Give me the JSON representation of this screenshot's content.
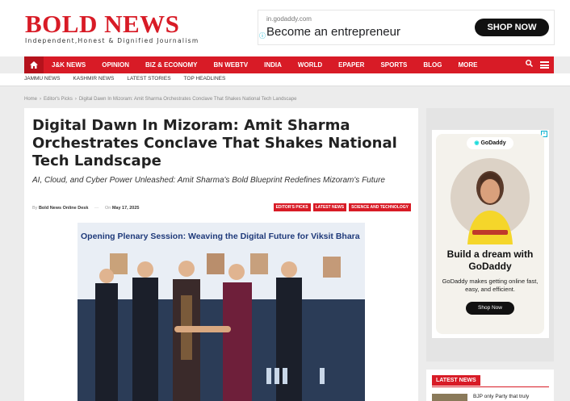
{
  "site": {
    "logo": "BOLD NEWS",
    "tagline": "Independent,Honest & Dignified Journalism"
  },
  "top_ad": {
    "domain": "in.godaddy.com",
    "headline": "Become an entrepreneur",
    "button": "SHOP NOW"
  },
  "nav": {
    "items": [
      "J&K NEWS",
      "OPINION",
      "BIZ & ECONOMY",
      "BN WEBTV",
      "INDIA",
      "WORLD",
      "EPAPER",
      "SPORTS",
      "BLOG",
      "MORE"
    ]
  },
  "subnav": {
    "items": [
      "JAMMU NEWS",
      "KASHMIR NEWS",
      "LATEST STORIES",
      "TOP HEADLINES"
    ]
  },
  "breadcrumb": [
    "Home",
    "Editor's Picks",
    "Digital Dawn In Mizoram: Amit Sharma Orchestrates Conclave That Shakes National Tech Landscape"
  ],
  "article": {
    "title": "Digital Dawn In Mizoram: Amit Sharma Orchestrates Conclave That Shakes National Tech Landscape",
    "subtitle": "AI, Cloud, and Cyber Power Unleashed: Amit Sharma's Bold Blueprint Redefines Mizoram's Future",
    "meta_by": "By",
    "author": "Bold News Online Desk",
    "meta_on": "On",
    "date": "May 17, 2025",
    "tags": [
      "EDITOR'S PICKS",
      "LATEST NEWS",
      "SCIENCE AND TECHNOLOGY"
    ],
    "photo_banner": "Opening Plenary Session: Weaving the Digital Future for Viksit Bhara"
  },
  "sidebar_ad": {
    "brand": "GoDaddy",
    "headline": "Build a dream with GoDaddy",
    "text": "GoDaddy makes getting online fast, easy, and efficient.",
    "button": "Shop Now"
  },
  "latest_news": {
    "heading": "LATEST NEWS",
    "first_item": "BJP only Party that truly"
  },
  "colors": {
    "brand_red": "#d81b26",
    "ad_accent": "#00aecd"
  }
}
